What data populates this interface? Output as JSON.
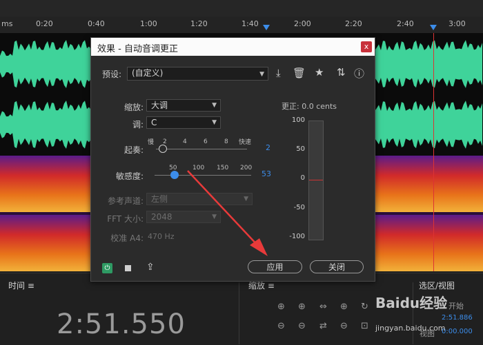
{
  "ruler": {
    "ticks": [
      "ms",
      "0:20",
      "0:40",
      "1:00",
      "1:20",
      "1:40",
      "2:00",
      "2:20",
      "2:40",
      "3:00"
    ]
  },
  "dialog": {
    "title": "效果 - 自动音调更正",
    "close_label": "x",
    "preset_label": "预设:",
    "preset_value": "(自定义)",
    "scale_label": "缩放:",
    "scale_value": "大调",
    "key_label": "调:",
    "key_value": "C",
    "attack_label": "起奏:",
    "attack_slow": "慢",
    "attack_ticks": [
      "2",
      "4",
      "6",
      "8"
    ],
    "attack_fast": "快速",
    "attack_value": "2",
    "sensitivity_label": "敏感度:",
    "sensitivity_ticks": [
      "50",
      "100",
      "150",
      "200"
    ],
    "sensitivity_value": "53",
    "ref_channel_label": "参考声道:",
    "ref_channel_value": "左侧",
    "fft_label": "FFT 大小:",
    "fft_value": "2048",
    "calib_label": "校准 A4:",
    "calib_value": "470 Hz",
    "correction_label": "更正: 0.0 cents",
    "meter_labels": [
      "100",
      "50",
      "0",
      "-50",
      "-100"
    ],
    "apply_label": "应用",
    "close_button_label": "关闭"
  },
  "panels": {
    "time_label": "时间",
    "zoom_label": "缩放",
    "selection_label": "选区/视图",
    "timecode": "2:51.550",
    "sel_start_label": "开始",
    "sel_start_value": "2:51.886",
    "view_label": "视图",
    "view_value": "0:00.000"
  },
  "watermark": {
    "brand": "Baidu经验",
    "url": "jingyan.baidu.com"
  },
  "colors": {
    "waveform": "#3fd39a",
    "accent": "#3c8dea",
    "playhead": "#dd3333",
    "close": "#c8313b",
    "arrow": "#e83a3a"
  }
}
